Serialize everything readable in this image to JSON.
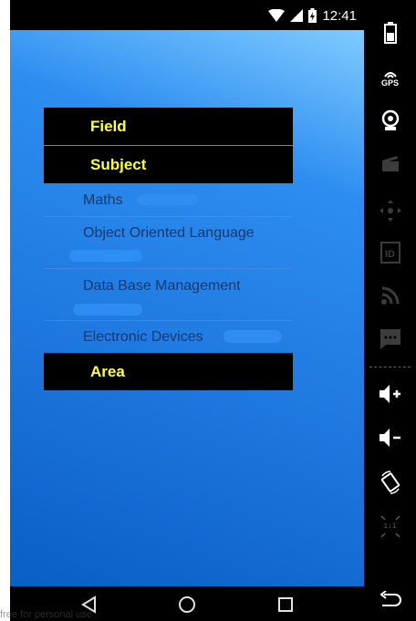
{
  "statusbar": {
    "time": "12:41"
  },
  "menu": {
    "groups": [
      {
        "label": "Field"
      },
      {
        "label": "Subject"
      },
      {
        "label": "Area"
      }
    ],
    "subject_children": [
      "Maths",
      "Object Oriented Language",
      "Data Base Management",
      "Electronic Devices"
    ]
  },
  "footer": {
    "faded_text": "free for personal use"
  },
  "toolbar": {
    "gps_label": "GPS",
    "ratio_label": "1:1"
  },
  "colors": {
    "group_header_bg": "#000000",
    "group_header_text": "#ffff3d",
    "child_text": "#16386b",
    "scribble": "#2f8ff5"
  }
}
